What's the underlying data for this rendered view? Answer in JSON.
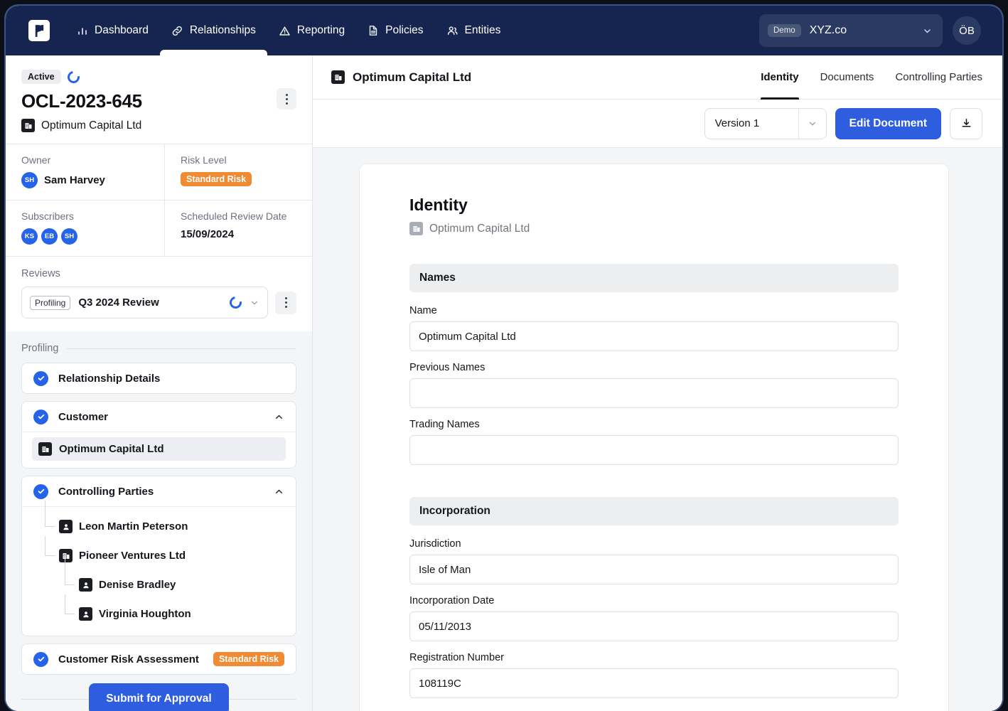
{
  "topnav": {
    "logo_name": "pega-logo",
    "items": [
      {
        "label": "Dashboard",
        "icon": "bar-chart-icon",
        "active": false
      },
      {
        "label": "Relationships",
        "icon": "link-icon",
        "active": true
      },
      {
        "label": "Reporting",
        "icon": "warning-triangle-icon",
        "active": false
      },
      {
        "label": "Policies",
        "icon": "document-icon",
        "active": false
      },
      {
        "label": "Entities",
        "icon": "users-icon",
        "active": false
      }
    ],
    "org": {
      "chip": "Demo",
      "name": "XYZ.co"
    },
    "avatar": "ÖB"
  },
  "sidebar": {
    "status": "Active",
    "reference": "OCL-2023-645",
    "entity": "Optimum Capital Ltd",
    "meta": {
      "owner_label": "Owner",
      "owner_initials": "SH",
      "owner_name": "Sam Harvey",
      "risk_label": "Risk Level",
      "risk_value": "Standard Risk",
      "subscribers_label": "Subscribers",
      "subscribers": [
        "KS",
        "EB",
        "SH"
      ],
      "review_date_label": "Scheduled Review Date",
      "review_date": "15/09/2024"
    },
    "reviews": {
      "label": "Reviews",
      "tag": "Profiling",
      "name": "Q3 2024 Review"
    },
    "profiling": {
      "section_label": "Profiling",
      "items": [
        {
          "title": "Relationship Details"
        },
        {
          "title": "Customer"
        },
        {
          "title": "Controlling Parties"
        },
        {
          "title": "Customer Risk Assessment",
          "badge": "Standard Risk"
        }
      ],
      "customer_entity": "Optimum Capital Ltd",
      "controlling_parties": [
        {
          "name": "Leon Martin Peterson",
          "type": "person",
          "level": 1
        },
        {
          "name": "Pioneer Ventures Ltd",
          "type": "company",
          "level": 1
        },
        {
          "name": "Denise Bradley",
          "type": "person",
          "level": 2
        },
        {
          "name": "Virginia Houghton",
          "type": "person",
          "level": 2
        }
      ]
    },
    "submit_label": "Submit for Approval"
  },
  "main": {
    "title": "Optimum Capital Ltd",
    "tabs": [
      {
        "label": "Identity",
        "active": true
      },
      {
        "label": "Documents",
        "active": false
      },
      {
        "label": "Controlling Parties",
        "active": false
      }
    ],
    "toolbar": {
      "version": "Version 1",
      "edit_label": "Edit Document",
      "download_icon": "download-icon"
    },
    "document": {
      "title": "Identity",
      "subtitle": "Optimum Capital Ltd",
      "groups": [
        {
          "heading": "Names",
          "fields": [
            {
              "label": "Name",
              "value": "Optimum Capital Ltd"
            },
            {
              "label": "Previous Names",
              "value": ""
            },
            {
              "label": "Trading Names",
              "value": ""
            }
          ]
        },
        {
          "heading": "Incorporation",
          "fields": [
            {
              "label": "Jurisdiction",
              "value": "Isle of Man"
            },
            {
              "label": "Incorporation Date",
              "value": "05/11/2013"
            },
            {
              "label": "Registration Number",
              "value": "108119C"
            }
          ]
        }
      ]
    }
  },
  "colors": {
    "nav_bg": "#16254f",
    "accent_blue": "#2f5de0",
    "risk_orange": "#f08a33",
    "canvas_bg": "#f4f5f7"
  }
}
